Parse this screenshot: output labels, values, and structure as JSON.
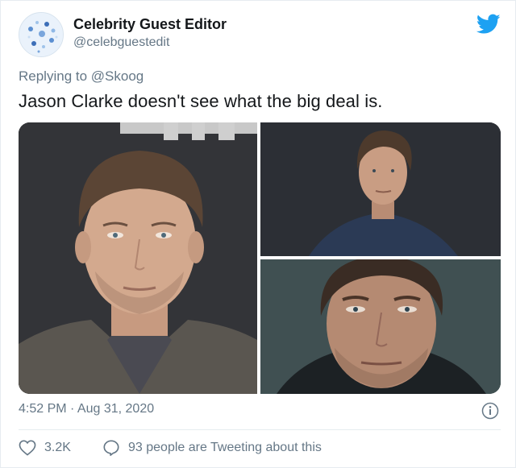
{
  "account": {
    "display_name": "Celebrity Guest Editor",
    "handle": "@celebguestedit",
    "platform_icon": "twitter-bird-icon"
  },
  "reply": {
    "prefix": "Replying to",
    "mention": "@Skoog"
  },
  "tweet": {
    "text": "Jason Clarke doesn't see what the big deal is."
  },
  "media": {
    "photos": [
      {
        "position": "left",
        "description_icon": "portrait-photo"
      },
      {
        "position": "top-right",
        "description_icon": "portrait-photo"
      },
      {
        "position": "bottom-right",
        "description_icon": "portrait-photo"
      }
    ]
  },
  "meta": {
    "timestamp": "4:52 PM · Aug 31, 2020"
  },
  "engagement": {
    "likes": "3.2K",
    "tweeting": "93 people are Tweeting about this"
  },
  "colors": {
    "accent": "#1da1f2",
    "secondary_text": "#657786",
    "primary_text": "#14171a",
    "divider": "#e6ecf0"
  }
}
